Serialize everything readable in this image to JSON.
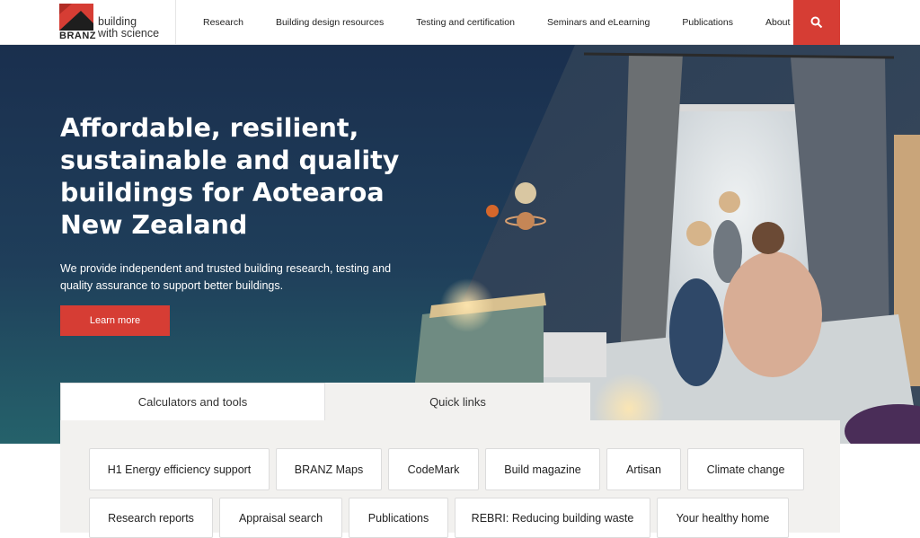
{
  "brand": {
    "name": "BRANZ",
    "tagline_line1": "building",
    "tagline_line2": "with science",
    "accent": "#d63d34"
  },
  "nav": {
    "items": [
      {
        "label": "Research"
      },
      {
        "label": "Building design resources"
      },
      {
        "label": "Testing and certification"
      },
      {
        "label": "Seminars and eLearning"
      },
      {
        "label": "Publications"
      },
      {
        "label": "About"
      }
    ],
    "search_icon": "search-icon"
  },
  "hero": {
    "title": "Affordable, resilient, sustainable and quality buildings for Aotearoa New Zealand",
    "description": "We provide independent and trusted building research, testing and quality assurance to support better buildings.",
    "cta_label": "Learn more"
  },
  "tabs": [
    {
      "label": "Calculators and tools"
    },
    {
      "label": "Quick links"
    }
  ],
  "quick_links": [
    {
      "label": "H1 Energy efficiency support"
    },
    {
      "label": "BRANZ Maps"
    },
    {
      "label": "CodeMark"
    },
    {
      "label": "Build magazine"
    },
    {
      "label": "Artisan"
    },
    {
      "label": "Climate change"
    },
    {
      "label": "Research reports"
    },
    {
      "label": "Appraisal search"
    },
    {
      "label": "Publications"
    },
    {
      "label": "REBRI: Reducing building waste"
    },
    {
      "label": "Your healthy home"
    }
  ]
}
